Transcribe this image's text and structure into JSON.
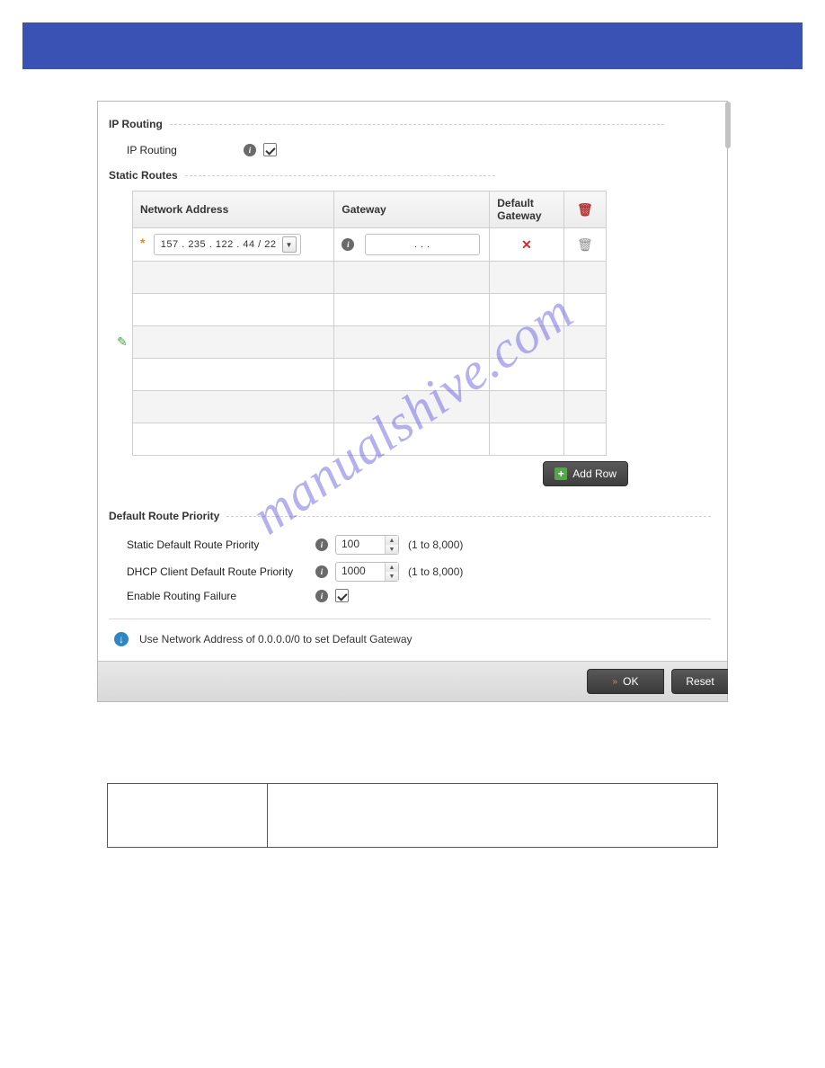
{
  "ipRouting": {
    "section_title": "IP Routing",
    "field_label": "IP Routing",
    "checked": true
  },
  "staticRoutes": {
    "section_title": "Static Routes",
    "columns": {
      "network_address": "Network Address",
      "gateway": "Gateway",
      "default_gateway": "Default Gateway"
    },
    "row": {
      "network_address": "157 . 235 . 122 .  44  /  22",
      "gateway": ".       .       .",
      "default_gateway_set": "✕"
    },
    "add_row_label": "Add Row"
  },
  "defaultRoutePriority": {
    "section_title": "Default Route Priority",
    "static_label": "Static Default Route Priority",
    "static_value": "100",
    "dhcp_label": "DHCP Client Default Route Priority",
    "dhcp_value": "1000",
    "range_hint": "(1 to 8,000)",
    "enable_failure_label": "Enable Routing Failure",
    "enable_failure_checked": true
  },
  "note_text": "Use Network Address of 0.0.0.0/0 to set Default Gateway",
  "buttons": {
    "ok": "OK",
    "reset": "Reset"
  },
  "watermark": "manualshive.com"
}
